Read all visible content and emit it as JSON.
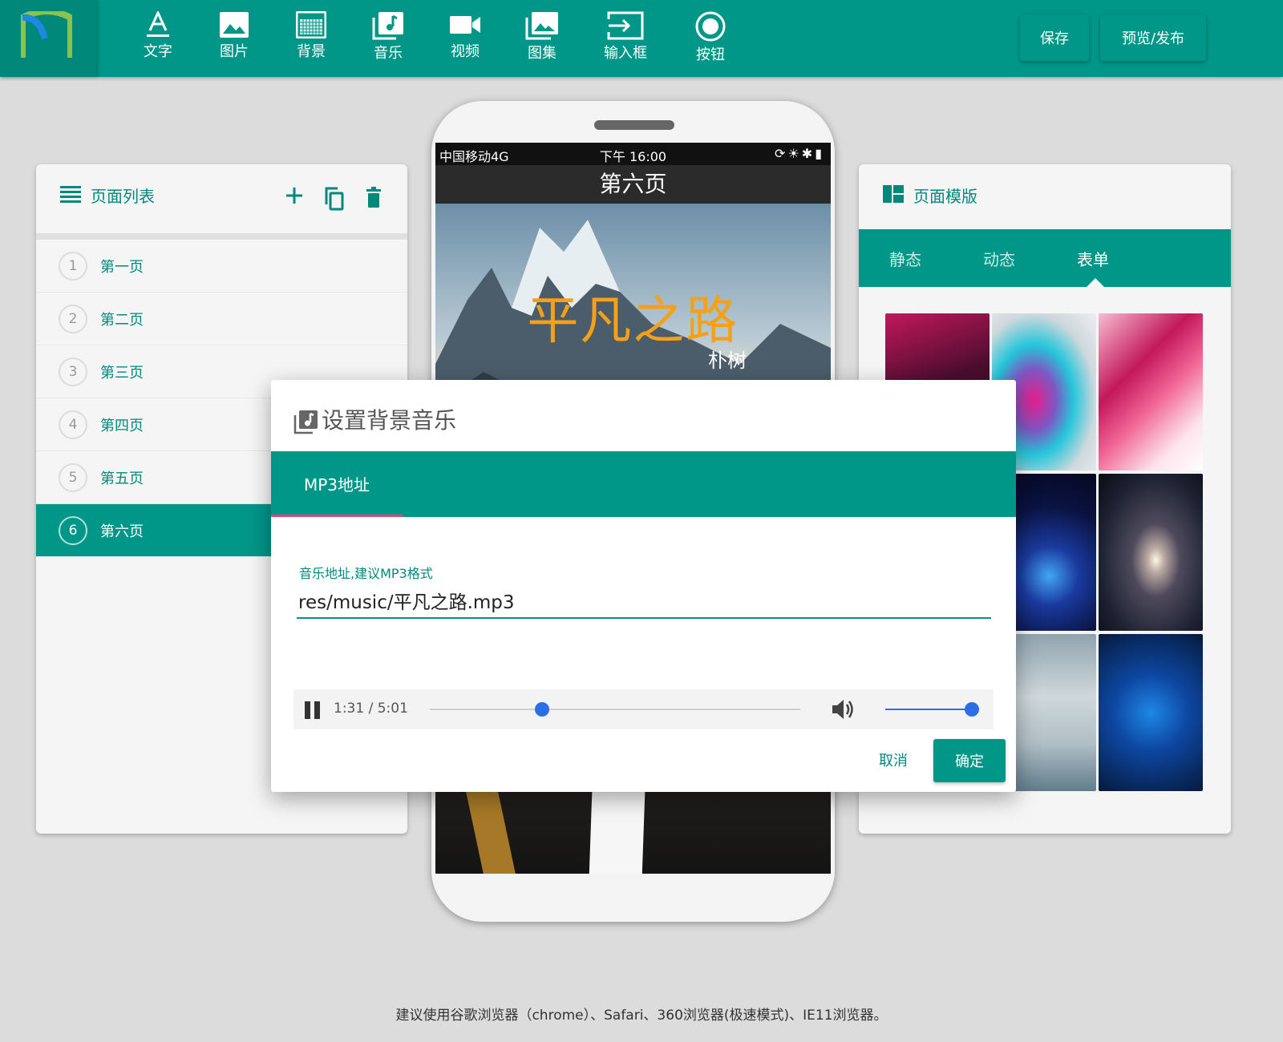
{
  "toolbar": {
    "items": [
      {
        "label": "文字",
        "icon": "text-icon"
      },
      {
        "label": "图片",
        "icon": "image-icon"
      },
      {
        "label": "背景",
        "icon": "background-icon"
      },
      {
        "label": "音乐",
        "icon": "music-icon"
      },
      {
        "label": "视频",
        "icon": "video-icon"
      },
      {
        "label": "图集",
        "icon": "gallery-icon"
      },
      {
        "label": "输入框",
        "icon": "input-icon"
      },
      {
        "label": "按钮",
        "icon": "button-icon"
      }
    ],
    "save_label": "保存",
    "publish_label": "预览/发布"
  },
  "page_list": {
    "title": "页面列表",
    "pages": [
      {
        "num": "1",
        "name": "第一页"
      },
      {
        "num": "2",
        "name": "第二页"
      },
      {
        "num": "3",
        "name": "第三页"
      },
      {
        "num": "4",
        "name": "第四页"
      },
      {
        "num": "5",
        "name": "第五页"
      },
      {
        "num": "6",
        "name": "第六页"
      }
    ],
    "active_index": 5
  },
  "phone": {
    "carrier": "中国移动4G",
    "time": "下午 16:00",
    "page_title": "第六页",
    "song_title": "平凡之路",
    "song_artist": "朴树"
  },
  "templates": {
    "title": "页面模版",
    "tabs": [
      "静态",
      "动态",
      "表单"
    ],
    "active_tab": 2
  },
  "dialog": {
    "title": "设置背景音乐",
    "tab_label": "MP3地址",
    "field_label": "音乐地址,建议MP3格式",
    "field_value": "res/music/平凡之路.mp3",
    "time_display": "1:31 / 5:01",
    "progress": 0.302,
    "volume": 1.0,
    "cancel_label": "取消",
    "ok_label": "确定"
  },
  "colors": {
    "primary": "#009688",
    "accent": "#ec407a",
    "player_blue": "#2b6fe6",
    "song_title": "#f4a019"
  },
  "footer": "建议使用谷歌浏览器（chrome）、Safari、360浏览器(极速模式)、IE11浏览器。"
}
